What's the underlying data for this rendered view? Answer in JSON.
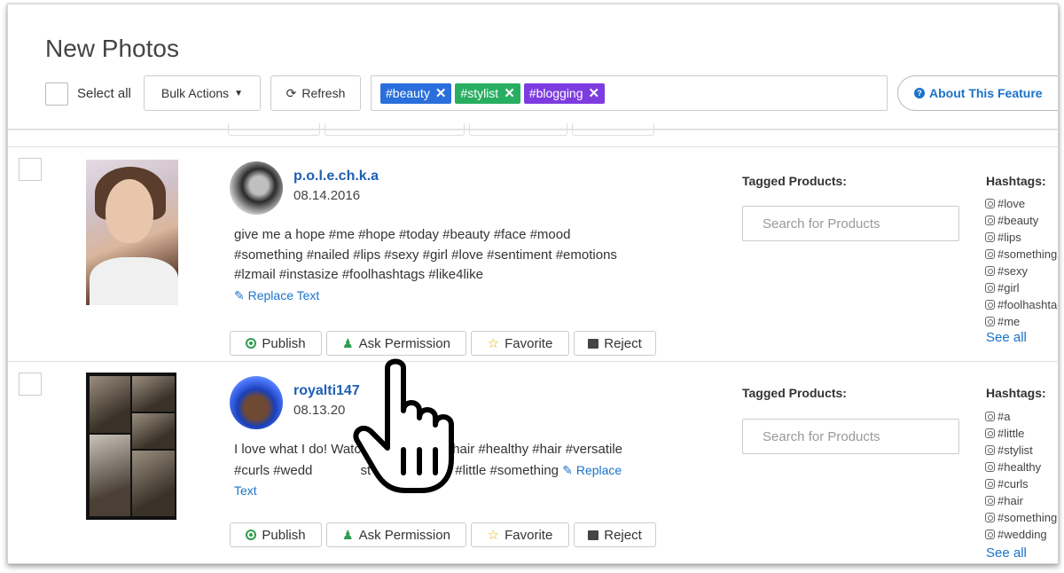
{
  "page": {
    "title": "New Photos"
  },
  "toolbar": {
    "select_all_label": "Select all",
    "bulk_actions_label": "Bulk Actions",
    "refresh_label": "Refresh",
    "tags": [
      {
        "label": "#beauty",
        "color": "#2a6fdb"
      },
      {
        "label": "#stylist",
        "color": "#27ae60"
      },
      {
        "label": "#blogging",
        "color": "#7d3ce0"
      }
    ],
    "about_label": "About This Feature"
  },
  "actions": {
    "publish": "Publish",
    "ask_permission": "Ask Permission",
    "favorite": "Favorite",
    "reject": "Reject",
    "replace_text": "Replace Text"
  },
  "labels": {
    "tagged_products": "Tagged Products:",
    "search_products_placeholder": "Search for Products",
    "hashtags": "Hashtags:",
    "see_all": "See all"
  },
  "posts": [
    {
      "username": "p.o.l.e.ch.k.a",
      "date": "08.14.2016",
      "caption": "give me a hope #me #hope #today #beauty #face #mood #something #nailed #lips #sexy #girl #love #sentiment #emotions #lzmail #instasize #foolhashtags #like4like",
      "hashtags": [
        "#love",
        "#beauty",
        "#lips",
        "#something",
        "#sexy",
        "#girl",
        "#foolhashtags",
        "#me"
      ]
    },
    {
      "username": "royalti147",
      "date": "08.13.20",
      "caption": "I love what I do! Watc                  longhair #healthy #hair #versatile #curls #wedd             st #saturday #a #little #something",
      "hashtags": [
        "#a",
        "#little",
        "#stylist",
        "#healthy",
        "#curls",
        "#hair",
        "#something",
        "#wedding"
      ]
    }
  ],
  "colors": {
    "link": "#1a73c9",
    "publish": "#2e9e4f",
    "favorite": "#e4b100"
  }
}
